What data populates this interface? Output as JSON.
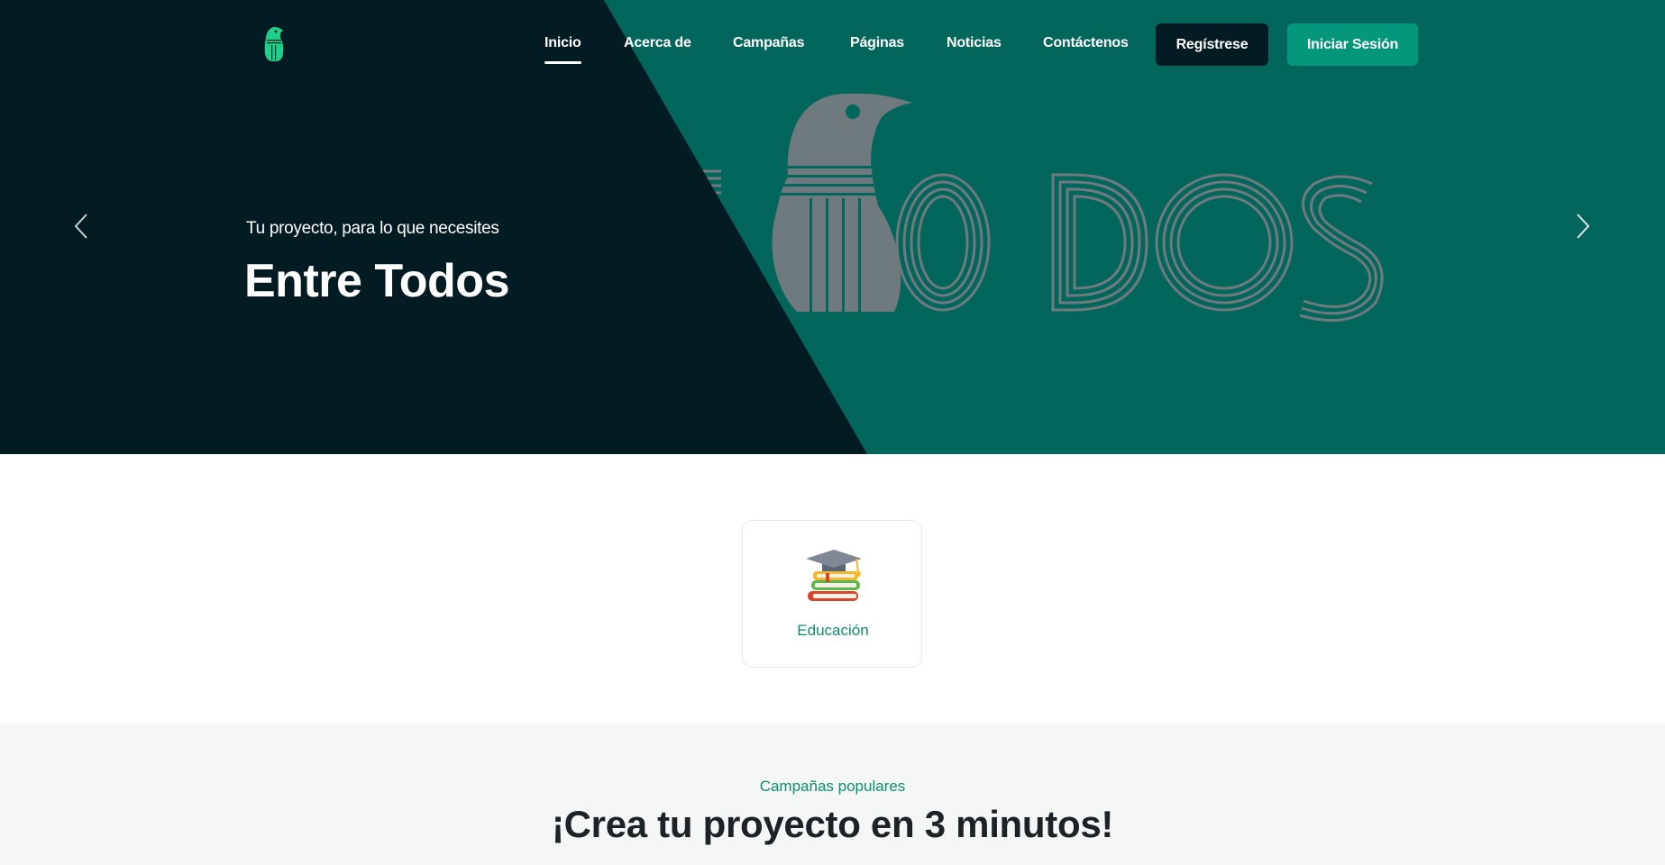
{
  "header": {
    "nav": [
      {
        "label": "Inicio",
        "active": true
      },
      {
        "label": "Acerca de",
        "active": false
      },
      {
        "label": "Campañas",
        "active": false
      },
      {
        "label": "Páginas",
        "active": false
      },
      {
        "label": "Noticias",
        "active": false
      },
      {
        "label": "Contáctenos",
        "active": false
      }
    ],
    "register_label": "Regístrese",
    "login_label": "Iniciar Sesión"
  },
  "hero": {
    "subtitle": "Tu proyecto, para lo que necesites",
    "title": "Entre Todos",
    "background_text": "TODOS",
    "colors": {
      "dark": "#031b22",
      "green": "#02665b",
      "art": "#6e7a7d"
    }
  },
  "categories": [
    {
      "label": "Educación",
      "icon": "education-books-icon"
    }
  ],
  "campaigns": {
    "kicker": "Campañas populares",
    "title": "¡Crea tu proyecto en 3 minutos!"
  },
  "colors": {
    "accent": "#05977a",
    "accent_text": "#0e8f6c",
    "dark_button": "#031b22"
  }
}
